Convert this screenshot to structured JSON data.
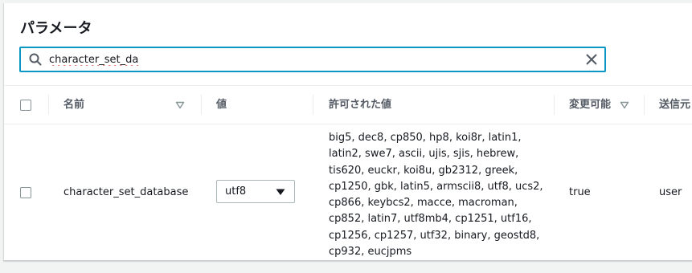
{
  "header": {
    "title": "パラメータ"
  },
  "search": {
    "value": "character_set_da"
  },
  "table": {
    "columns": [
      "名前",
      "値",
      "許可された値",
      "変更可能",
      "送信元"
    ],
    "rows": [
      {
        "name": "character_set_database",
        "value": "utf8",
        "allowed_values_lines": [
          "big5, dec8, cp850, hp8, koi8r, latin1,",
          "latin2, swe7, ascii, ujis, sjis, hebrew,",
          "tis620, euckr, koi8u, gb2312, greek,",
          "cp1250, gbk, latin5, armscii8, utf8, ucs2,",
          "cp866, keybcs2, macce, macroman,",
          "cp852, latin7, utf8mb4, cp1251, utf16,",
          "cp1256, cp1257, utf32, binary, geostd8,",
          "cp932, eucjpms"
        ],
        "modifiable": "true",
        "source": "user"
      }
    ]
  },
  "colors": {
    "accent": "#0a97c4",
    "header_text": "#545b64",
    "border": "#eaeded"
  },
  "icons": [
    "search-icon",
    "clear-icon",
    "sort-icon",
    "caret-down-icon"
  ]
}
